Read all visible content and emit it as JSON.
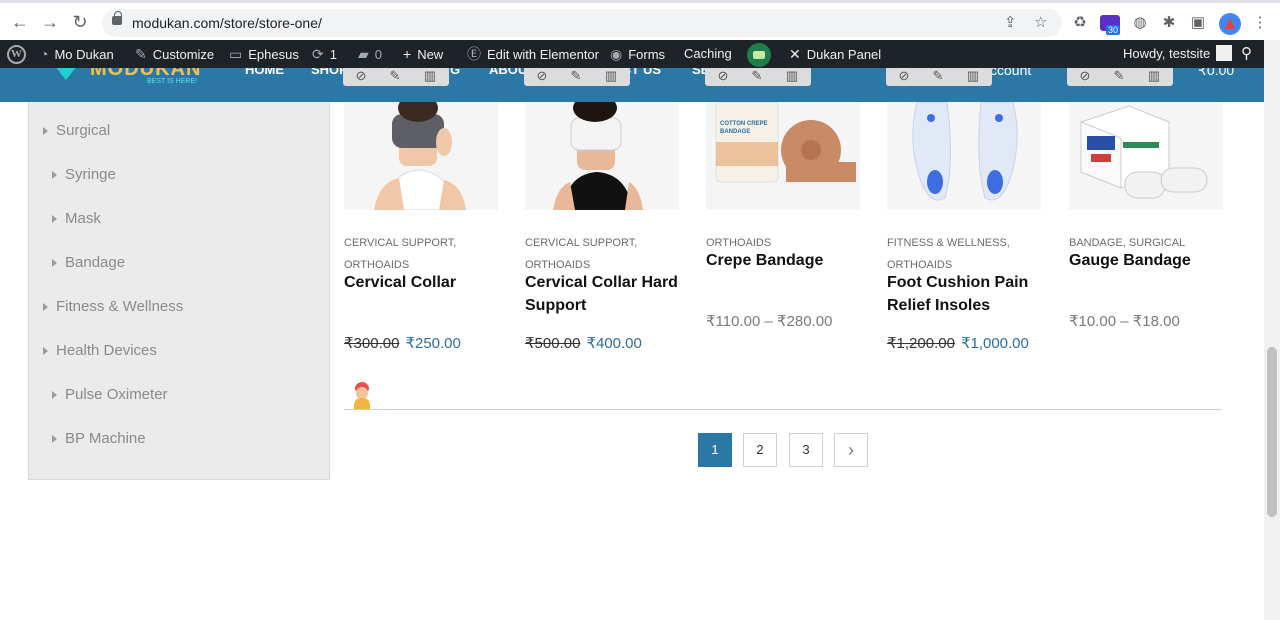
{
  "browser": {
    "url": "modukan.com/store/store-one/",
    "notification_count": "30"
  },
  "adminbar": {
    "wp_logo": "W",
    "site_name": "Mo Dukan",
    "customize": "Customize",
    "theme": "Ephesus",
    "updates_count": "1",
    "comments_count": "0",
    "new": "New",
    "edit_elementor": "Edit with Elementor",
    "forms": "Forms",
    "caching": "Caching",
    "dukan_panel": "Dukan Panel",
    "howdy": "Howdy, testsite"
  },
  "siteheader": {
    "logo": "MODUKAN",
    "tagline": "BEST IS HERE!",
    "nav": [
      "HOME",
      "SHOP",
      "G",
      "ABOU",
      "CT US",
      "SE"
    ],
    "account": "ccount",
    "cart_total": "₹0.00"
  },
  "sidebar": {
    "categories": [
      {
        "label": "Surgical"
      },
      {
        "label": "Syringe"
      },
      {
        "label": "Mask"
      },
      {
        "label": "Bandage"
      },
      {
        "label": "Fitness & Wellness"
      },
      {
        "label": "Health Devices"
      },
      {
        "label": "Pulse Oximeter"
      },
      {
        "label": "BP Machine"
      }
    ]
  },
  "products": [
    {
      "categories": [
        "CERVICAL SUPPORT,",
        "ORTHOAIDS"
      ],
      "title": "Cervical Collar",
      "old_price": "₹300.00",
      "price": "₹250.00"
    },
    {
      "categories": [
        "CERVICAL SUPPORT,",
        "ORTHOAIDS"
      ],
      "title": "Cervical Collar Hard Support",
      "old_price": "₹500.00",
      "price": "₹400.00"
    },
    {
      "categories": [
        "ORTHOAIDS"
      ],
      "title": "Crepe Bandage",
      "price_range": "₹110.00 – ₹280.00",
      "image_text": "COTTON CREPE BANDAGE"
    },
    {
      "categories": [
        "FITNESS & WELLNESS,",
        "ORTHOAIDS"
      ],
      "title": "Foot Cushion Pain Relief Insoles",
      "old_price": "₹1,200.00",
      "price": "₹1,000.00"
    },
    {
      "categories": [
        "BANDAGE,",
        "SURGICAL"
      ],
      "title": "Gauge Bandage",
      "price_range": "₹10.00 – ₹18.00"
    }
  ],
  "pagination": {
    "pages": [
      "1",
      "2",
      "3"
    ],
    "next": "›",
    "current": "1"
  },
  "colors": {
    "header": "#2b78a6",
    "adminbar": "#1d2327",
    "price": "#2b6f9e",
    "sidebar": "#ebebeb"
  }
}
